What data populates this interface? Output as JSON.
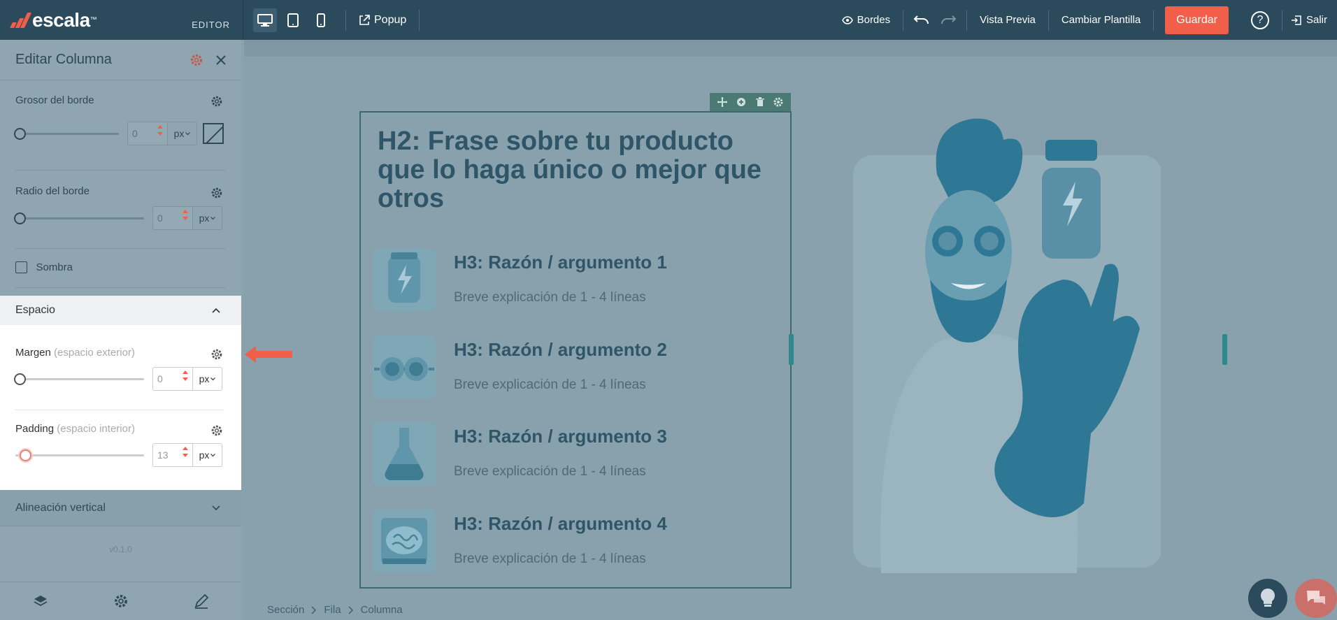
{
  "app": {
    "brand": "escala",
    "brand_tm": "™",
    "mode": "EDITOR"
  },
  "topbar": {
    "popup": "Popup",
    "bordes": "Bordes",
    "vista_previa": "Vista Previa",
    "cambiar_plantilla": "Cambiar Plantilla",
    "guardar": "Guardar",
    "help": "?",
    "salir": "Salir",
    "active_device": "desktop"
  },
  "sidebar": {
    "title": "Editar Columna",
    "grosor": {
      "label": "Grosor del borde",
      "value": "0",
      "unit": "px"
    },
    "radio": {
      "label": "Radio del borde",
      "value": "0",
      "unit": "px"
    },
    "sombra": {
      "label": "Sombra",
      "checked": false
    },
    "espacio": {
      "label": "Espacio",
      "margen": {
        "label": "Margen",
        "hint": "(espacio exterior)",
        "value": "0",
        "unit": "px"
      },
      "padding": {
        "label": "Padding",
        "hint": "(espacio interior)",
        "value": "13",
        "unit": "px"
      }
    },
    "alineacion": "Alineación vertical",
    "version": "v0.1.0"
  },
  "canvas": {
    "heading": "H2: Frase sobre tu producto que lo haga único o mejor que otros",
    "features": [
      {
        "title": "H3: Razón / argumento 1",
        "desc": "Breve explicación de 1 - 4 líneas",
        "icon": "battery-jar-icon"
      },
      {
        "title": "H3: Razón / argumento 2",
        "desc": "Breve explicación de 1 - 4 líneas",
        "icon": "goggles-icon"
      },
      {
        "title": "H3: Razón / argumento 3",
        "desc": "Breve explicación de 1 - 4 líneas",
        "icon": "flask-icon"
      },
      {
        "title": "H3: Razón / argumento 4",
        "desc": "Breve explicación de 1 - 4 líneas",
        "icon": "brain-jar-icon"
      }
    ]
  },
  "breadcrumb": [
    "Sección",
    "Fila",
    "Columna"
  ],
  "colors": {
    "accent": "#f15f4a",
    "topbar": "#2b4a5c",
    "overlay": "#89a1ac"
  }
}
